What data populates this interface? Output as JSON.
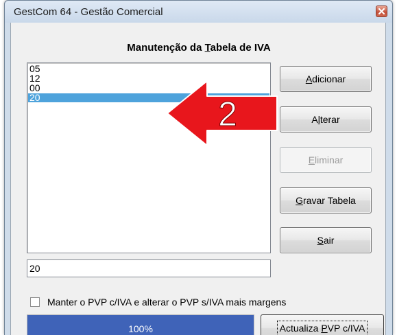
{
  "window": {
    "title": "GestCom 64 - Gestão Comercial",
    "close_glyph": "×"
  },
  "dialog": {
    "heading_pre": "Manutenção da ",
    "heading_mnemonic": "T",
    "heading_post": "abela de IVA"
  },
  "list": {
    "items": [
      "05",
      "12",
      "00",
      "20"
    ],
    "selected_index": 3
  },
  "edit": {
    "value": "20"
  },
  "buttons": {
    "adicionar": {
      "mnemonic": "A",
      "rest": "dicionar"
    },
    "alterar": {
      "pre": "A",
      "mnemonic": "l",
      "rest": "terar"
    },
    "eliminar": {
      "mnemonic": "E",
      "rest": "liminar"
    },
    "gravar": {
      "mnemonic": "G",
      "rest": "ravar Tabela"
    },
    "sair": {
      "mnemonic": "S",
      "rest": "air"
    },
    "actualiza": {
      "pre": "Actualiza ",
      "mnemonic": "P",
      "rest": "VP c/IVA"
    }
  },
  "checkbox": {
    "label": "Manter o PVP c/IVA e alterar o PVP s/IVA mais margens",
    "checked": false
  },
  "progress": {
    "value": 100,
    "label": "100%"
  },
  "annotation": {
    "number": "2",
    "arrow_color": "#e8161c"
  },
  "colors": {
    "selection": "#4ea3dc",
    "progress_fill": "#3f63b8"
  }
}
